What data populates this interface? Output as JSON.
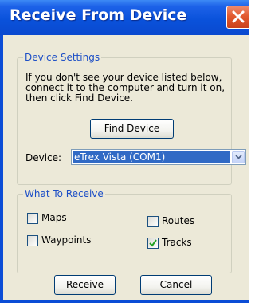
{
  "window": {
    "title": "Receive From Device"
  },
  "device_settings": {
    "legend": "Device Settings",
    "info_line1": "If you don't see your device listed below,",
    "info_line2": "connect it to the computer and turn it on,",
    "info_line3": "then click Find Device.",
    "find_button": "Find Device",
    "device_label": "Device:",
    "device_selected": "eTrex Vista (COM1)"
  },
  "what_to_receive": {
    "legend": "What To Receive",
    "options": [
      {
        "label": "Maps",
        "checked": false
      },
      {
        "label": "Routes",
        "checked": false
      },
      {
        "label": "Waypoints",
        "checked": false
      },
      {
        "label": "Tracks",
        "checked": true
      }
    ]
  },
  "buttons": {
    "receive": "Receive",
    "cancel": "Cancel"
  },
  "colors": {
    "title_bar": "#0a52db",
    "legend_text": "#1d4fc6",
    "selection": "#316ac5",
    "close": "#e25a2f",
    "dialog_bg": "#ece9d8"
  }
}
